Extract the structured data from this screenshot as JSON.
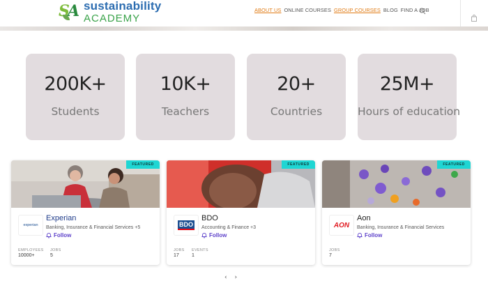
{
  "header": {
    "logo_line1": "sustainability",
    "logo_line2": "ACADEMY",
    "nav": [
      {
        "label": "ABOUT US"
      },
      {
        "label": "ONLINE COURSES"
      },
      {
        "label": "GROUP COURSES"
      },
      {
        "label": "BLOG"
      },
      {
        "label": "FIND A JOB"
      }
    ]
  },
  "stats": [
    {
      "value": "200K+",
      "label": "Students"
    },
    {
      "value": "10K+",
      "label": "Teachers"
    },
    {
      "value": "20+",
      "label": "Countries"
    },
    {
      "value": "25M+",
      "label": "Hours of education"
    }
  ],
  "cards": [
    {
      "badge": "FEATURED",
      "name": "Experian",
      "logo_text": "experian",
      "industry": "Banking, Insurance & Financial Services +5",
      "follow": "Follow",
      "meta": [
        {
          "label": "EMPLOYEES",
          "value": "10000+"
        },
        {
          "label": "JOBS",
          "value": "5"
        }
      ]
    },
    {
      "badge": "FEATURED",
      "name": "BDO",
      "logo_text": "BDO",
      "industry": "Accounting & Finance +3",
      "follow": "Follow",
      "meta": [
        {
          "label": "JOBS",
          "value": "17"
        },
        {
          "label": "EVENTS",
          "value": "1"
        }
      ]
    },
    {
      "badge": "FEATURED",
      "name": "Aon",
      "logo_text": "AON",
      "industry": "Banking, Insurance & Financial Services",
      "follow": "Follow",
      "meta": [
        {
          "label": "JOBS",
          "value": "7"
        }
      ]
    }
  ],
  "colors": {
    "accent": "#e07b14",
    "follow": "#5b3fc9",
    "badge": "#1fd6d3",
    "stat_bg": "#e2dcdf"
  },
  "icons": {
    "search": "search-icon",
    "cart": "shopping-bag-icon",
    "bell": "bell-icon"
  }
}
